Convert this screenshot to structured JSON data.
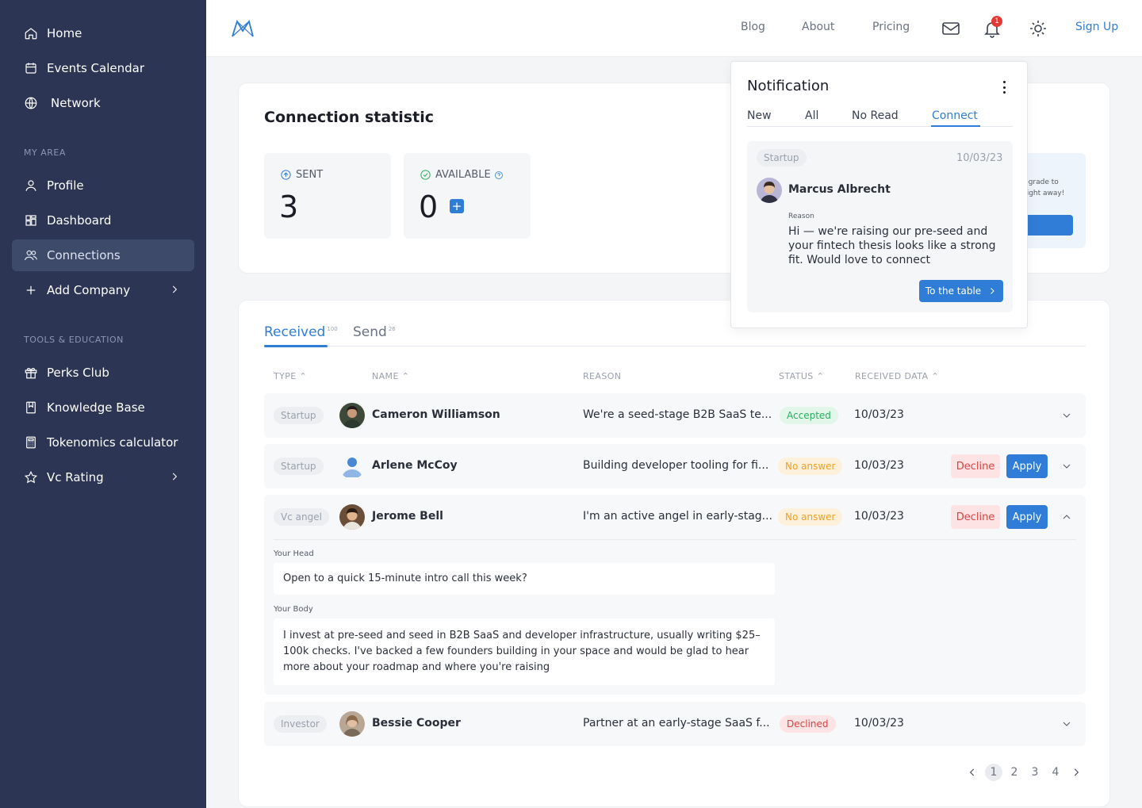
{
  "sidebar": {
    "items_top": [
      {
        "label": "Home",
        "icon": "home-icon"
      },
      {
        "label": "Events Calendar",
        "icon": "calendar-icon"
      },
      {
        "label": "Network",
        "icon": "globe-icon"
      }
    ],
    "section_my_area": "MY AREA",
    "items_my_area": [
      {
        "label": "Profile",
        "icon": "user-icon"
      },
      {
        "label": "Dashboard",
        "icon": "dashboard-icon"
      },
      {
        "label": "Connections",
        "icon": "users-icon"
      },
      {
        "label": "Add Company",
        "icon": "plus-icon"
      }
    ],
    "section_tools": "TOOLS & EDUCATION",
    "items_tools": [
      {
        "label": "Perks Club",
        "icon": "gift-icon"
      },
      {
        "label": "Knowledge Base",
        "icon": "book-icon"
      },
      {
        "label": "Tokenomics calculator",
        "icon": "calculator-icon"
      },
      {
        "label": "Vc Rating",
        "icon": "star-icon"
      }
    ]
  },
  "header": {
    "links": [
      "Blog",
      "About",
      "Pricing"
    ],
    "notification_count": "1",
    "signup": "Sign Up"
  },
  "stats": {
    "title": "Connection statistic",
    "sent_label": "SENT",
    "sent_value": "3",
    "available_label": "AVAILABLE",
    "available_value": "0",
    "upgrade_text": "pgrade to right away!"
  },
  "tabs": {
    "received": "Received",
    "received_count": "100",
    "send": "Send",
    "send_count": "26"
  },
  "columns": [
    "TYPE",
    "NAME",
    "REASON",
    "STATUS",
    "RECEIVED DATA"
  ],
  "rows": [
    {
      "type": "Startup",
      "name": "Cameron Williamson",
      "reason": "We're a seed-stage B2B SaaS te...",
      "status": "Accepted",
      "date": "10/03/23"
    },
    {
      "type": "Startup",
      "name": "Arlene McCoy",
      "reason": "Building developer tooling for fi...",
      "status": "No answer",
      "date": "10/03/23"
    },
    {
      "type": "Vc angel",
      "name": "Jerome Bell",
      "reason": "I'm an active angel in early-stag...",
      "status": "No answer",
      "date": "10/03/23"
    },
    {
      "type": "Investor",
      "name": "Bessie Cooper",
      "reason": "Partner at an early-stage SaaS f...",
      "status": "Declined",
      "date": "10/03/23"
    }
  ],
  "actions": {
    "decline": "Decline",
    "apply": "Apply"
  },
  "expanded": {
    "head_label": "Your Head",
    "head_value": "Open to a quick 15-minute intro call this week?",
    "body_label": "Your Body",
    "body_value": "I invest at pre-seed and seed in B2B SaaS and developer infrastructure, usually writing $25–100k checks. I've backed a few founders building in your space and would be glad to hear more about your roadmap and where you're raising"
  },
  "pagination": {
    "pages": [
      "1",
      "2",
      "3",
      "4"
    ],
    "current": "1"
  },
  "notification": {
    "title": "Notification",
    "tabs": [
      "New",
      "All",
      "No Read",
      "Connect"
    ],
    "active_tab": "Connect",
    "item": {
      "type": "Startup",
      "date": "10/03/23",
      "name": "Marcus Albrecht",
      "reason_label": "Reason",
      "reason": "Hi — we're raising our pre-seed and your fintech thesis looks like a strong fit. Would love to connect",
      "button": "To the table"
    }
  },
  "colors": {
    "sidebar_bg": "#2c3553",
    "accent": "#2f7dd6",
    "accepted": "#27ae60",
    "no_answer": "#f0a020",
    "declined": "#d64545"
  }
}
